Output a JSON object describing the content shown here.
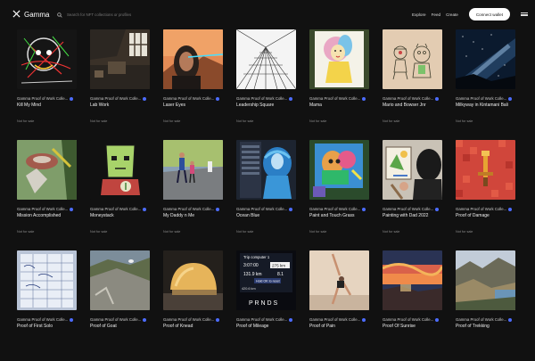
{
  "header": {
    "brand": "Gamma",
    "search_placeholder": "Search for NFT collections or profiles",
    "nav": [
      "Explore",
      "Feed",
      "Create"
    ],
    "connect_wallet": "Connect wallet",
    "icons": {
      "logo": "gamma-logo-icon",
      "search": "search-icon",
      "menu": "menu-icon"
    }
  },
  "collection_name": "Gamma Proof of Work Colle...",
  "verified_color": "#4c6cff",
  "items": [
    {
      "title": "Kill My Mind",
      "price": "Not for sale"
    },
    {
      "title": "Lab Work",
      "price": "Not for sale"
    },
    {
      "title": "Laser Eyes",
      "price": "Not for sale"
    },
    {
      "title": "Leadership Square",
      "price": "Not for sale"
    },
    {
      "title": "Mama",
      "price": "Not for sale"
    },
    {
      "title": "Mario and Bowser Jnr",
      "price": "Not for sale"
    },
    {
      "title": "Milkyway in Kintamani Bali",
      "price": "Not for sale"
    },
    {
      "title": "Mission Accomplished",
      "price": "Not for sale"
    },
    {
      "title": "Moneystack",
      "price": "Not for sale"
    },
    {
      "title": "My Daddy n Me",
      "price": "Not for sale"
    },
    {
      "title": "Ocean Blue",
      "price": "Not for sale"
    },
    {
      "title": "Paint and Touch Grass",
      "price": "Not for sale"
    },
    {
      "title": "Painting with Dad 2022",
      "price": "Not for sale"
    },
    {
      "title": "Proof of Damage",
      "price": "Not for sale"
    },
    {
      "title": "Proof of First Solo",
      "price": ""
    },
    {
      "title": "Proof of Goat",
      "price": ""
    },
    {
      "title": "Proof of Knead",
      "price": ""
    },
    {
      "title": "Proof of Mileage",
      "price": ""
    },
    {
      "title": "Proof of Pain",
      "price": ""
    },
    {
      "title": "Proof Of Sunrise",
      "price": ""
    },
    {
      "title": "Proof of Trekking",
      "price": ""
    }
  ],
  "mileage_thumb": {
    "heading": "Trip computer 1",
    "time": "3:07:00",
    "distance": "275 km",
    "fuel": "131.9 km",
    "avg": "8.1",
    "hold": "Hold OK to reset",
    "odo": "420.6 km",
    "gears": "P R N D S"
  }
}
